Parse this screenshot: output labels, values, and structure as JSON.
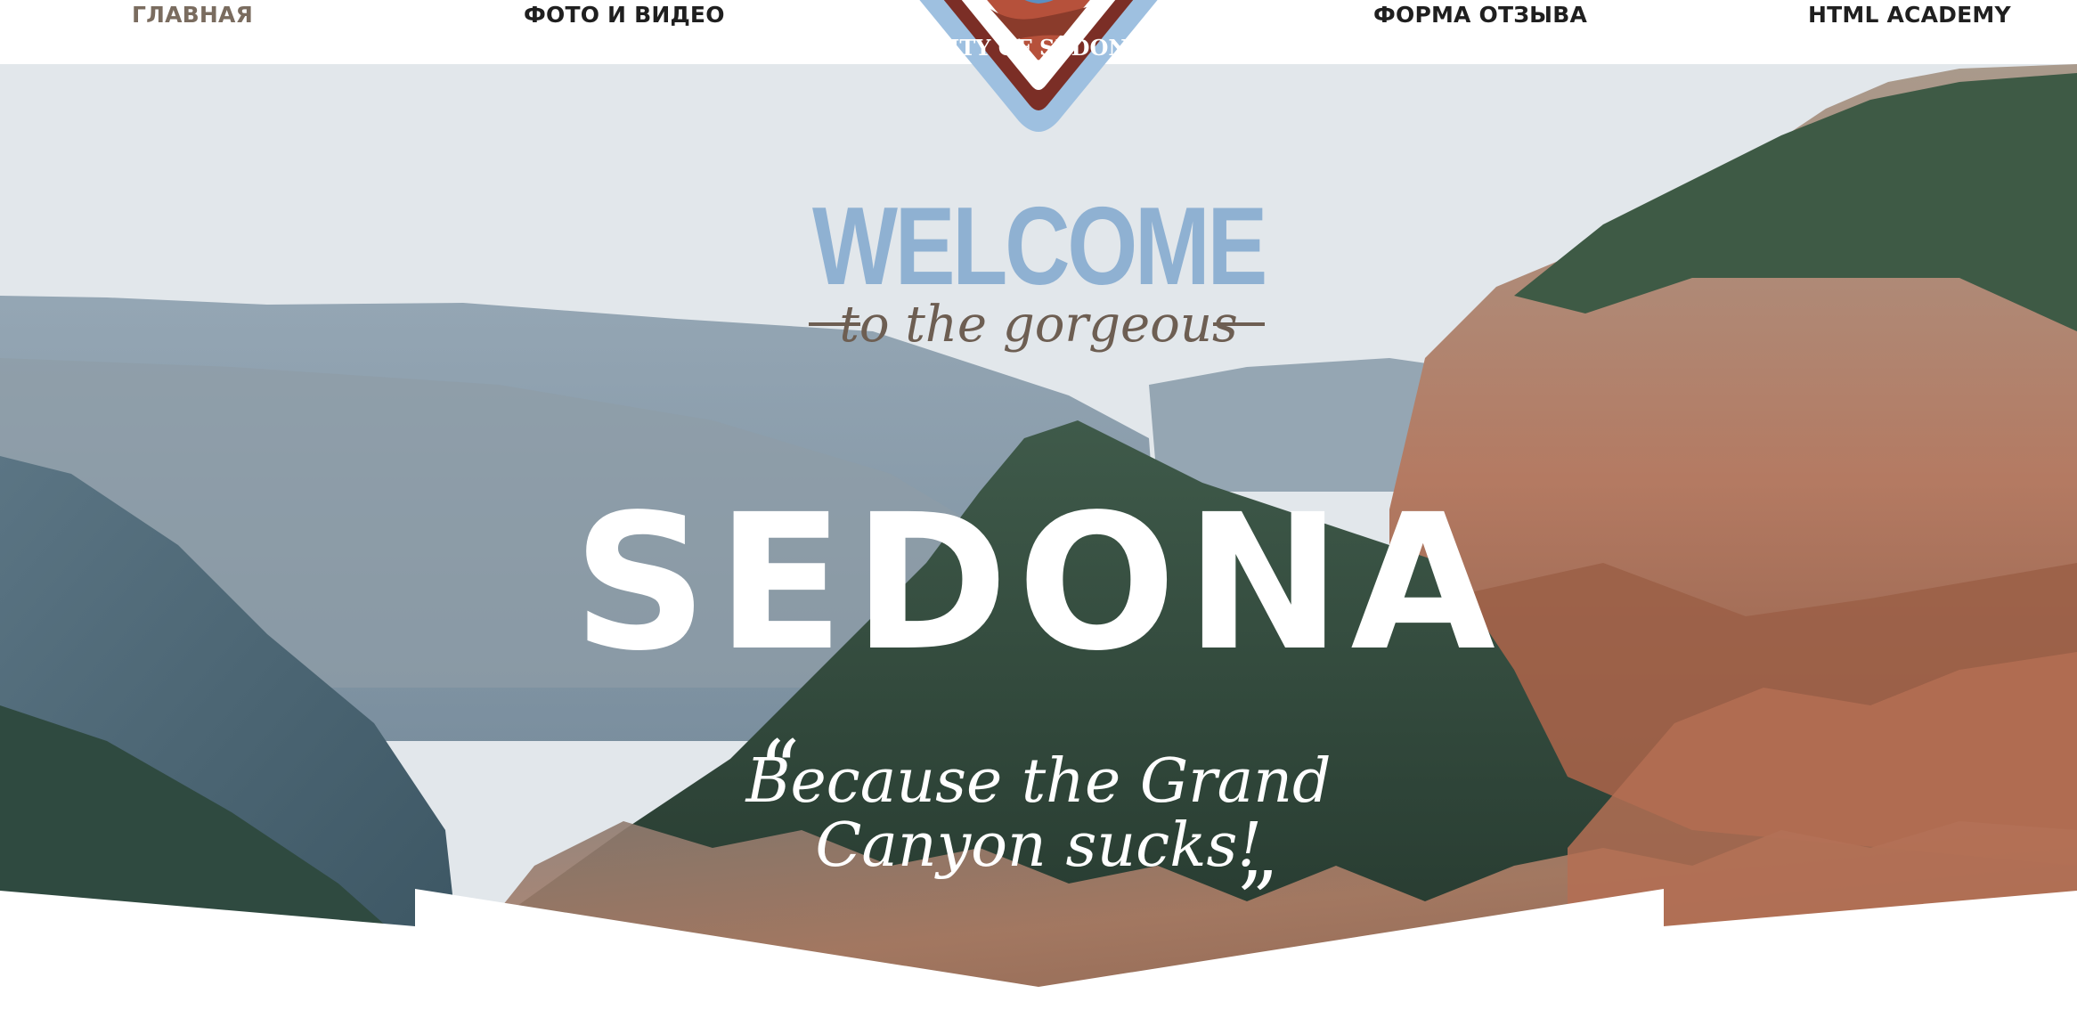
{
  "nav": {
    "items": [
      {
        "label": "ГЛАВНАЯ",
        "active": true
      },
      {
        "label": "ФОТО И ВИДЕО",
        "active": false
      },
      {
        "label": "ФОРМА ОТЗЫВА",
        "active": false
      },
      {
        "label": "HTML ACADEMY",
        "active": false
      }
    ]
  },
  "logo": {
    "text": "CITY OF SEDONA"
  },
  "hero": {
    "welcome": "WELCOME",
    "subline": "to the gorgeous",
    "title": "SEDONA",
    "quote_open": "“",
    "quote_line1": "Because the Grand",
    "quote_line2": "Canyon sucks!",
    "quote_close": "„"
  },
  "colors": {
    "accent_blue": "#8fb1d2",
    "brown": "#6d5e52",
    "active_nav": "#7a6c5f",
    "text_dark": "#1f1f1f"
  },
  "icons": [
    "logo-emblem"
  ]
}
